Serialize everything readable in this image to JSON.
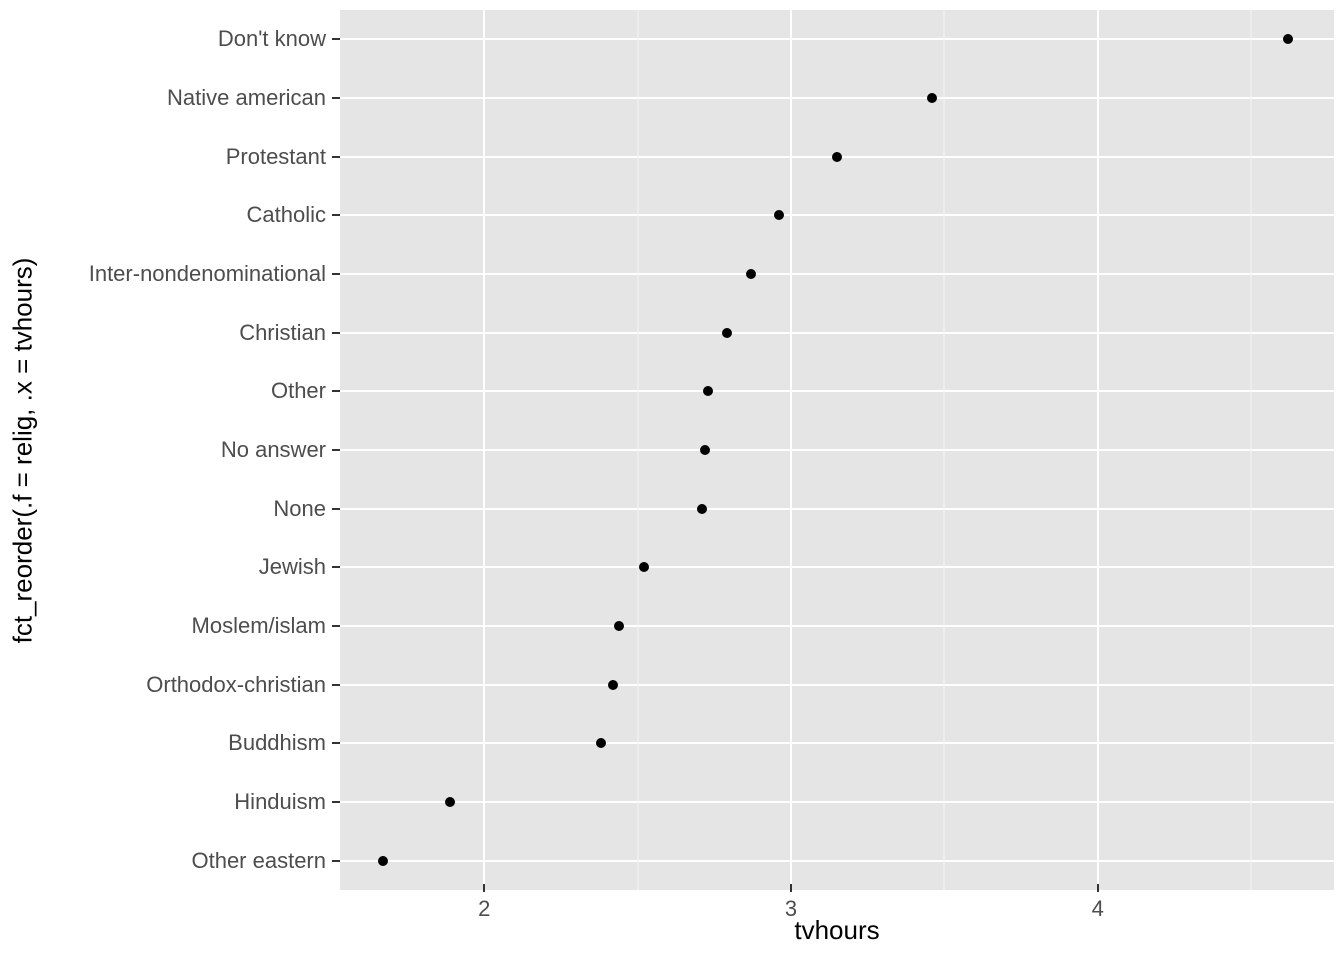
{
  "chart_data": {
    "type": "scatter",
    "xlabel": "tvhours",
    "ylabel": "fct_reorder(.f = relig, .x = tvhours)",
    "xlim": [
      1.53,
      4.77
    ],
    "x_ticks": [
      2,
      3,
      4
    ],
    "x_minor_ticks": [
      1.5,
      2.5,
      3.5,
      4.5
    ],
    "categories": [
      "Other eastern",
      "Hinduism",
      "Buddhism",
      "Orthodox-christian",
      "Moslem/islam",
      "Jewish",
      "None",
      "No answer",
      "Other",
      "Christian",
      "Inter-nondenominational",
      "Catholic",
      "Protestant",
      "Native american",
      "Don't know"
    ],
    "values": [
      1.67,
      1.89,
      2.38,
      2.42,
      2.44,
      2.52,
      2.71,
      2.72,
      2.73,
      2.79,
      2.87,
      2.96,
      3.15,
      3.46,
      4.62
    ]
  }
}
